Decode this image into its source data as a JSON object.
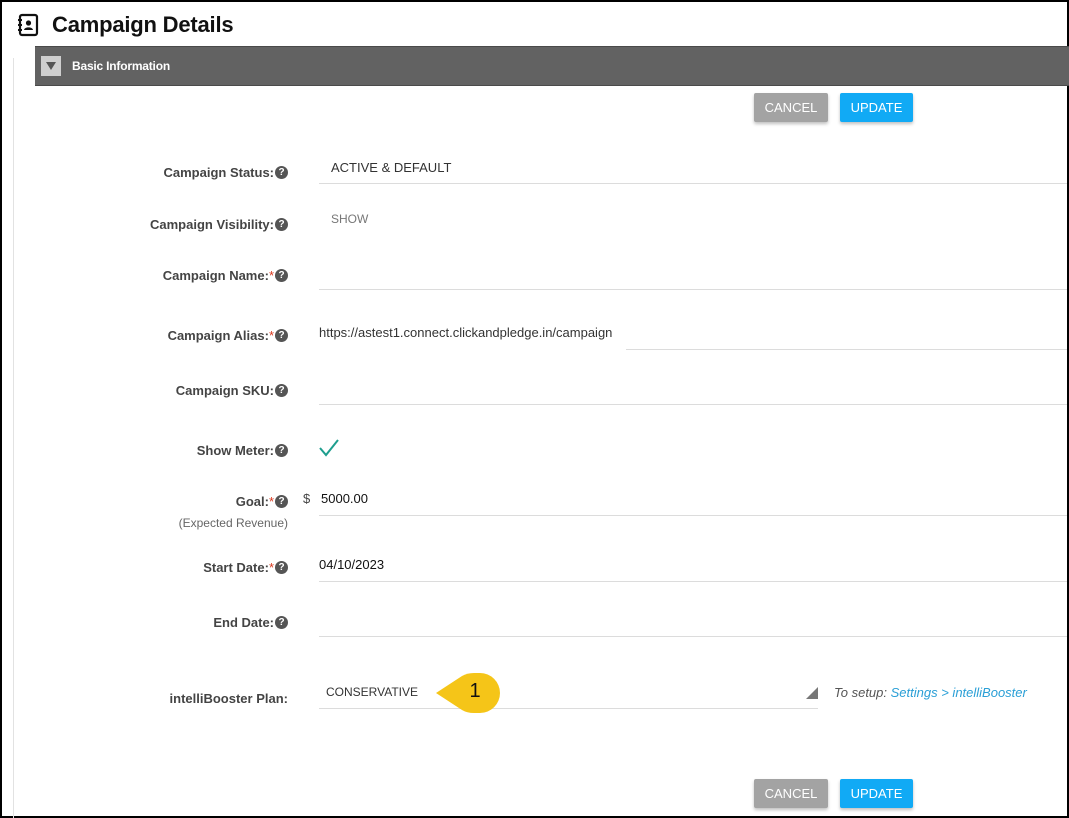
{
  "header": {
    "title": "Campaign Details",
    "icon": "contacts-book-icon"
  },
  "section": {
    "title": "Basic Information",
    "toggle_icon": "triangle-down-icon"
  },
  "buttons": {
    "cancel": "CANCEL",
    "update": "UPDATE"
  },
  "colors": {
    "update_button": "#11aaf5",
    "cancel_button": "#a3a3a3",
    "section_bar": "#626262",
    "required": "#d9381e",
    "link": "#2a9fd6",
    "badge": "#f5c518"
  },
  "fields": {
    "status": {
      "label": "Campaign Status:",
      "value": "ACTIVE & DEFAULT"
    },
    "visibility": {
      "label": "Campaign Visibility:",
      "value": "SHOW"
    },
    "name": {
      "label": "Campaign Name:",
      "required": "*",
      "value": ""
    },
    "alias": {
      "label": "Campaign Alias:",
      "required": "*",
      "prefix": "https://astest1.connect.clickandpledge.in/campaign",
      "value": ""
    },
    "sku": {
      "label": "Campaign SKU:",
      "value": ""
    },
    "meter": {
      "label": "Show Meter:",
      "checked": true
    },
    "goal": {
      "label": "Goal:",
      "required": "*",
      "sublabel": "(Expected Revenue)",
      "currency": "$",
      "value": "5000.00"
    },
    "start_date": {
      "label": "Start Date:",
      "required": "*",
      "value": "04/10/2023"
    },
    "end_date": {
      "label": "End Date:",
      "value": ""
    },
    "booster": {
      "label": "intelliBooster Plan:",
      "value": "CONSERVATIVE",
      "setup_prefix": "To setup:",
      "setup_link": "Settings > intelliBooster"
    }
  },
  "help_glyph": "?",
  "callout": {
    "number": "1"
  }
}
